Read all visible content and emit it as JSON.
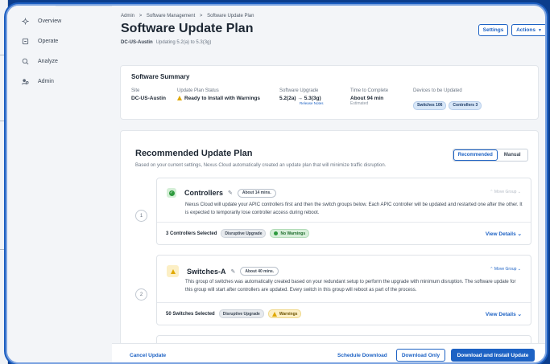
{
  "sidebar": {
    "items": [
      {
        "label": "Overview",
        "icon": "overview-icon"
      },
      {
        "label": "Operate",
        "icon": "operate-icon"
      },
      {
        "label": "Analyze",
        "icon": "analyze-icon"
      },
      {
        "label": "Admin",
        "icon": "admin-icon"
      }
    ]
  },
  "breadcrumb": [
    "Admin",
    ">",
    "Software Management",
    ">",
    "Software Update Plan"
  ],
  "page": {
    "title": "Software Update Plan",
    "site_name": "DC-US-Austin",
    "subtitle": "Updating 5.2(a) to 5.3(3g)"
  },
  "header_buttons": {
    "settings": "Settings",
    "actions": "Actions"
  },
  "summary": {
    "title": "Software Summary",
    "site_label": "Site",
    "site_value": "DC-US-Austin",
    "status_label": "Update Plan Status",
    "status_value": "Ready to Install with Warnings",
    "upgrade_label": "Software Upgrade",
    "upgrade_from": "5.2(2a)",
    "upgrade_arrow": "→",
    "upgrade_to": "5.3(3g)",
    "release_notes": "Release Notes",
    "time_label": "Time to Complete",
    "time_value": "About 94 min",
    "time_note": "Estimated",
    "devices_label": "Devices to be Updated",
    "devices_chips": [
      "Switches 106",
      "Controllers 3"
    ]
  },
  "plan": {
    "title": "Recommended Update Plan",
    "description": "Based on your current settings, Nexus Cloud automatically created an update plan that will minimize traffic disruption.",
    "toggle": {
      "recommended": "Recommended",
      "manual": "Manual"
    },
    "move_group": "Move Group",
    "groups": [
      {
        "step": "1",
        "name": "Controllers",
        "time": "About 14 mins.",
        "description": "Nexus Cloud will update your APIC controllers first and then the switch groups below. Each APIC controller will be updated and restarted one after the other. It is expected to temporarily lose controller access during reboot.",
        "selected": "3 Controllers Selected",
        "tag": "Disruptive Upgrade",
        "status": "No Warnings",
        "view_details": "View Details"
      },
      {
        "step": "2",
        "name": "Switches-A",
        "time": "About 40 mins.",
        "description": "This group of switches was automatically created based on your redundant setup to perform the upgrade with minimum disruption. The software update for this group will start after controllers are updated. Every switch in this group will reboot as part of the process.",
        "selected": "50 Switches Selected",
        "tag": "Disruptive Upgrade",
        "status": "Warnings",
        "view_details": "View Details"
      }
    ]
  },
  "footer": {
    "cancel": "Cancel Update",
    "schedule": "Schedule Download",
    "download_only": "Download Only",
    "download_install": "Download and Install Update"
  },
  "colors": {
    "accent": "#1d62c4",
    "frame": "#0b3d8c",
    "success": "#2d9a3d",
    "warning": "#e0a800"
  }
}
